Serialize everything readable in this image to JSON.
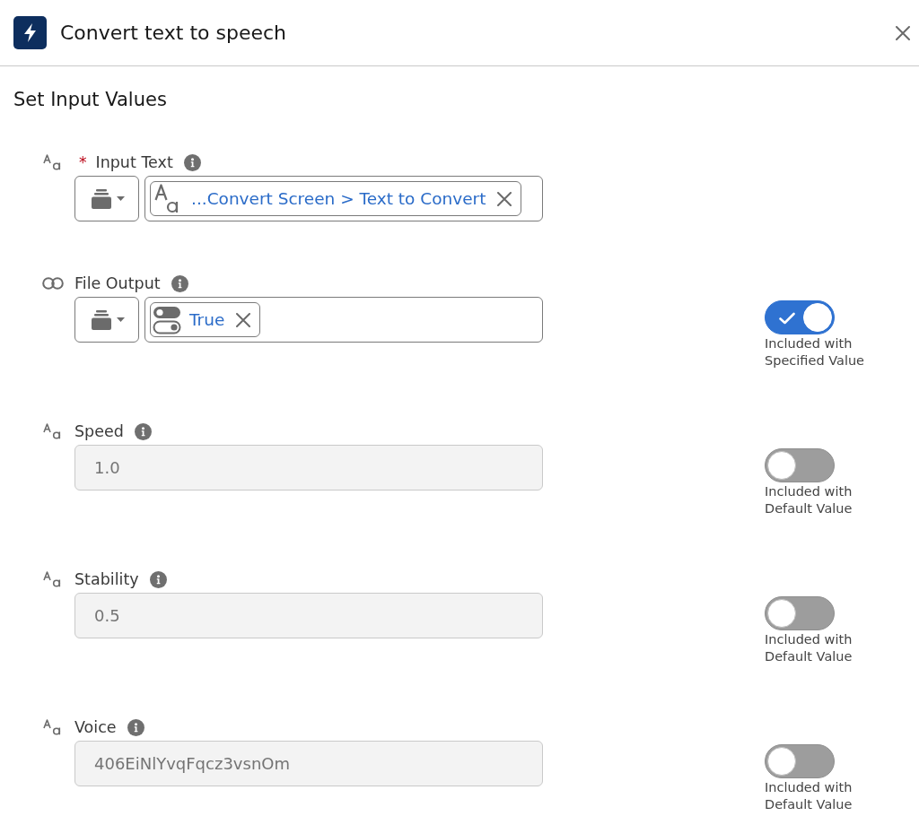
{
  "header": {
    "title": "Convert text to speech"
  },
  "section": {
    "title": "Set Input Values"
  },
  "inputs": [
    {
      "label": "Input Text",
      "required_mark": "*",
      "kind": "text",
      "disabled": false,
      "resource": "...Convert Screen > Text to Convert"
    },
    {
      "label": "File Output",
      "kind": "boolean",
      "disabled": false,
      "resource": "True",
      "toggle": {
        "on": true,
        "label": "Included with Specified Value"
      }
    },
    {
      "label": "Speed",
      "kind": "text",
      "disabled": true,
      "value": "1.0",
      "toggle": {
        "on": false,
        "label": "Included with Default Value"
      }
    },
    {
      "label": "Stability",
      "kind": "text",
      "disabled": true,
      "value": "0.5",
      "toggle": {
        "on": false,
        "label": "Included with Default Value"
      }
    },
    {
      "label": "Voice",
      "kind": "text",
      "disabled": true,
      "value": "406EiNlYvqFqcz3vsnOm",
      "toggle": {
        "on": false,
        "label": "Included with Default Value"
      }
    }
  ]
}
